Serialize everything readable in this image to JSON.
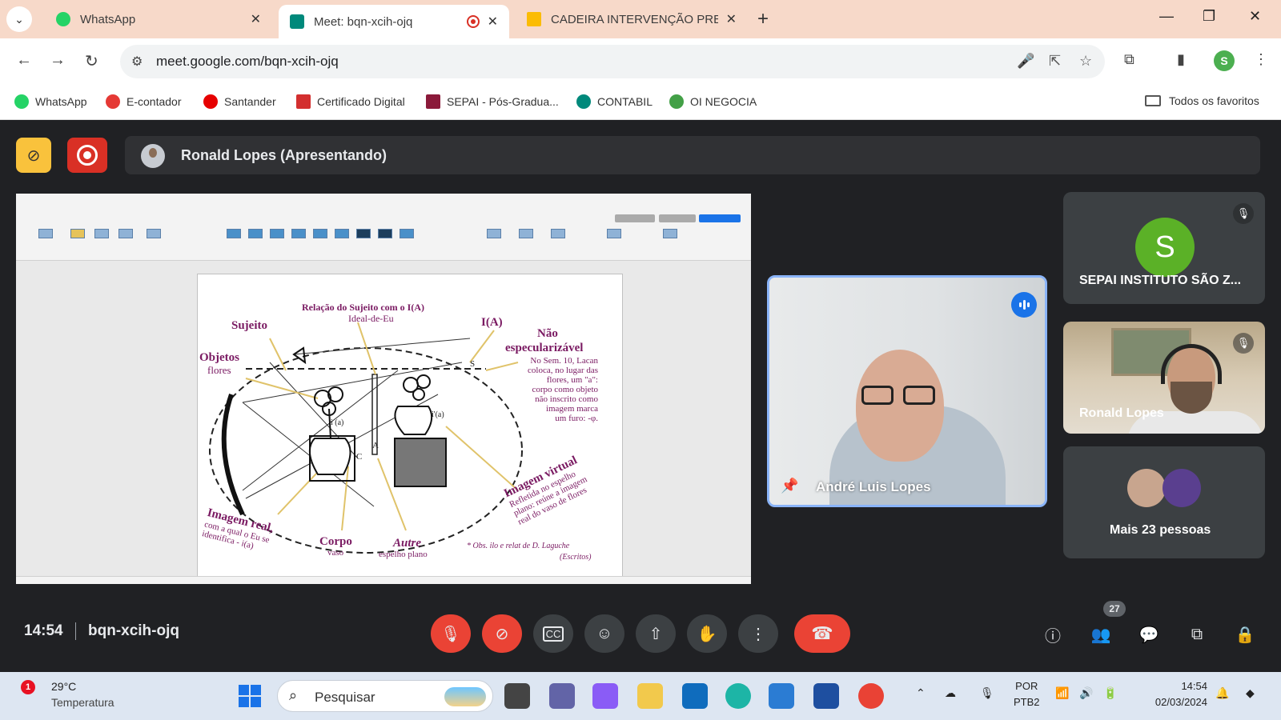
{
  "browser": {
    "tabs": [
      {
        "title": "WhatsApp",
        "favicon_color": "#25d366",
        "active": false
      },
      {
        "title": "Meet: bqn-xcih-ojq",
        "favicon_color": "#00897b",
        "active": true,
        "recording": true
      },
      {
        "title": "CADEIRA INTERVENÇÃO PREC",
        "favicon_color": "#fbbc04",
        "active": false
      }
    ],
    "tab_close_glyph": "✕",
    "new_tab_glyph": "+",
    "window_controls": [
      "—",
      "❐",
      "✕"
    ],
    "url": "meet.google.com/bqn-xcih-ojq",
    "profile_initial": "S",
    "profile_color": "#4caf50",
    "bookmarks": [
      {
        "label": "WhatsApp",
        "color": "#25d366"
      },
      {
        "label": "E-contador",
        "color": "#e53935"
      },
      {
        "label": "Santander",
        "color": "#e60000"
      },
      {
        "label": "Certificado Digital",
        "color": "#d32f2f"
      },
      {
        "label": "SEPAI - Pós-Gradua...",
        "color": "#8b1a3a"
      },
      {
        "label": "CONTABIL",
        "color": "#00897b"
      },
      {
        "label": "OI NEGOCIA",
        "color": "#43a047"
      }
    ],
    "all_bookmarks_label": "Todos os favoritos"
  },
  "meet": {
    "presenter_label": "Ronald Lopes (Apresentando)",
    "time": "14:54",
    "meeting_code": "bqn-xcih-ojq",
    "participant_count": "27",
    "participants": [
      {
        "name": "André Luis Lopes",
        "pinned": true,
        "speaking": true
      },
      {
        "name": "SEPAI INSTITUTO SÃO Z...",
        "avatar_letter": "S",
        "avatar_color": "#5bb127",
        "muted": true
      },
      {
        "name": "Ronald Lopes",
        "muted": true
      }
    ],
    "more_people": "Mais 23 pessoas",
    "controls": [
      "mic-off",
      "camera-off",
      "captions",
      "emoji",
      "present",
      "raise-hand",
      "more",
      "end-call"
    ],
    "accent_red": "#ea4335",
    "accent_blue": "#8ab4f8"
  },
  "shared_doc": {
    "title": "Relação do Sujeito com o I(A)",
    "subtitle": "Ideal-de-Eu",
    "labels": {
      "sujeito": "Sujeito",
      "ia": "I(A)",
      "objetos": "Objetos",
      "flores": "flores",
      "nao_espec": "Não",
      "nao_espec2": "especularizável",
      "nao_espec_text": [
        "No Sem. 10, Lacan",
        "coloca, no lugar das",
        "flores, um \"a\":",
        "corpo como objeto",
        "não inscrito como",
        "imagem marca",
        "um furo: -φ."
      ],
      "imagem_real": "Imagem real,",
      "imagem_real_text": [
        "com a qual o Eu se",
        "identifica - i(a)"
      ],
      "corpo": "Corpo",
      "vaso": "vaso",
      "autre": "Autre",
      "espelho": "espelho plano",
      "imagem_virtual": "Imagem virtual",
      "imagem_virtual_text": [
        "Refletida no espelho",
        "plano: reúne a imagem",
        "real do vaso de flores"
      ],
      "obs": "* Obs. ilo e relat de D. Laguche",
      "escritos": "(Escritos)",
      "small_a": "A",
      "small_c": "C",
      "small_s": "S",
      "small_ia": "i (a)",
      "small_ia2": "i'(a)"
    }
  },
  "taskbar": {
    "weather_temp": "29°C",
    "weather_label": "Temperatura",
    "weather_badge": "1",
    "search_placeholder": "Pesquisar",
    "lang_line1": "POR",
    "lang_line2": "PTB2",
    "clock_time": "14:54",
    "clock_date": "02/03/2024"
  }
}
